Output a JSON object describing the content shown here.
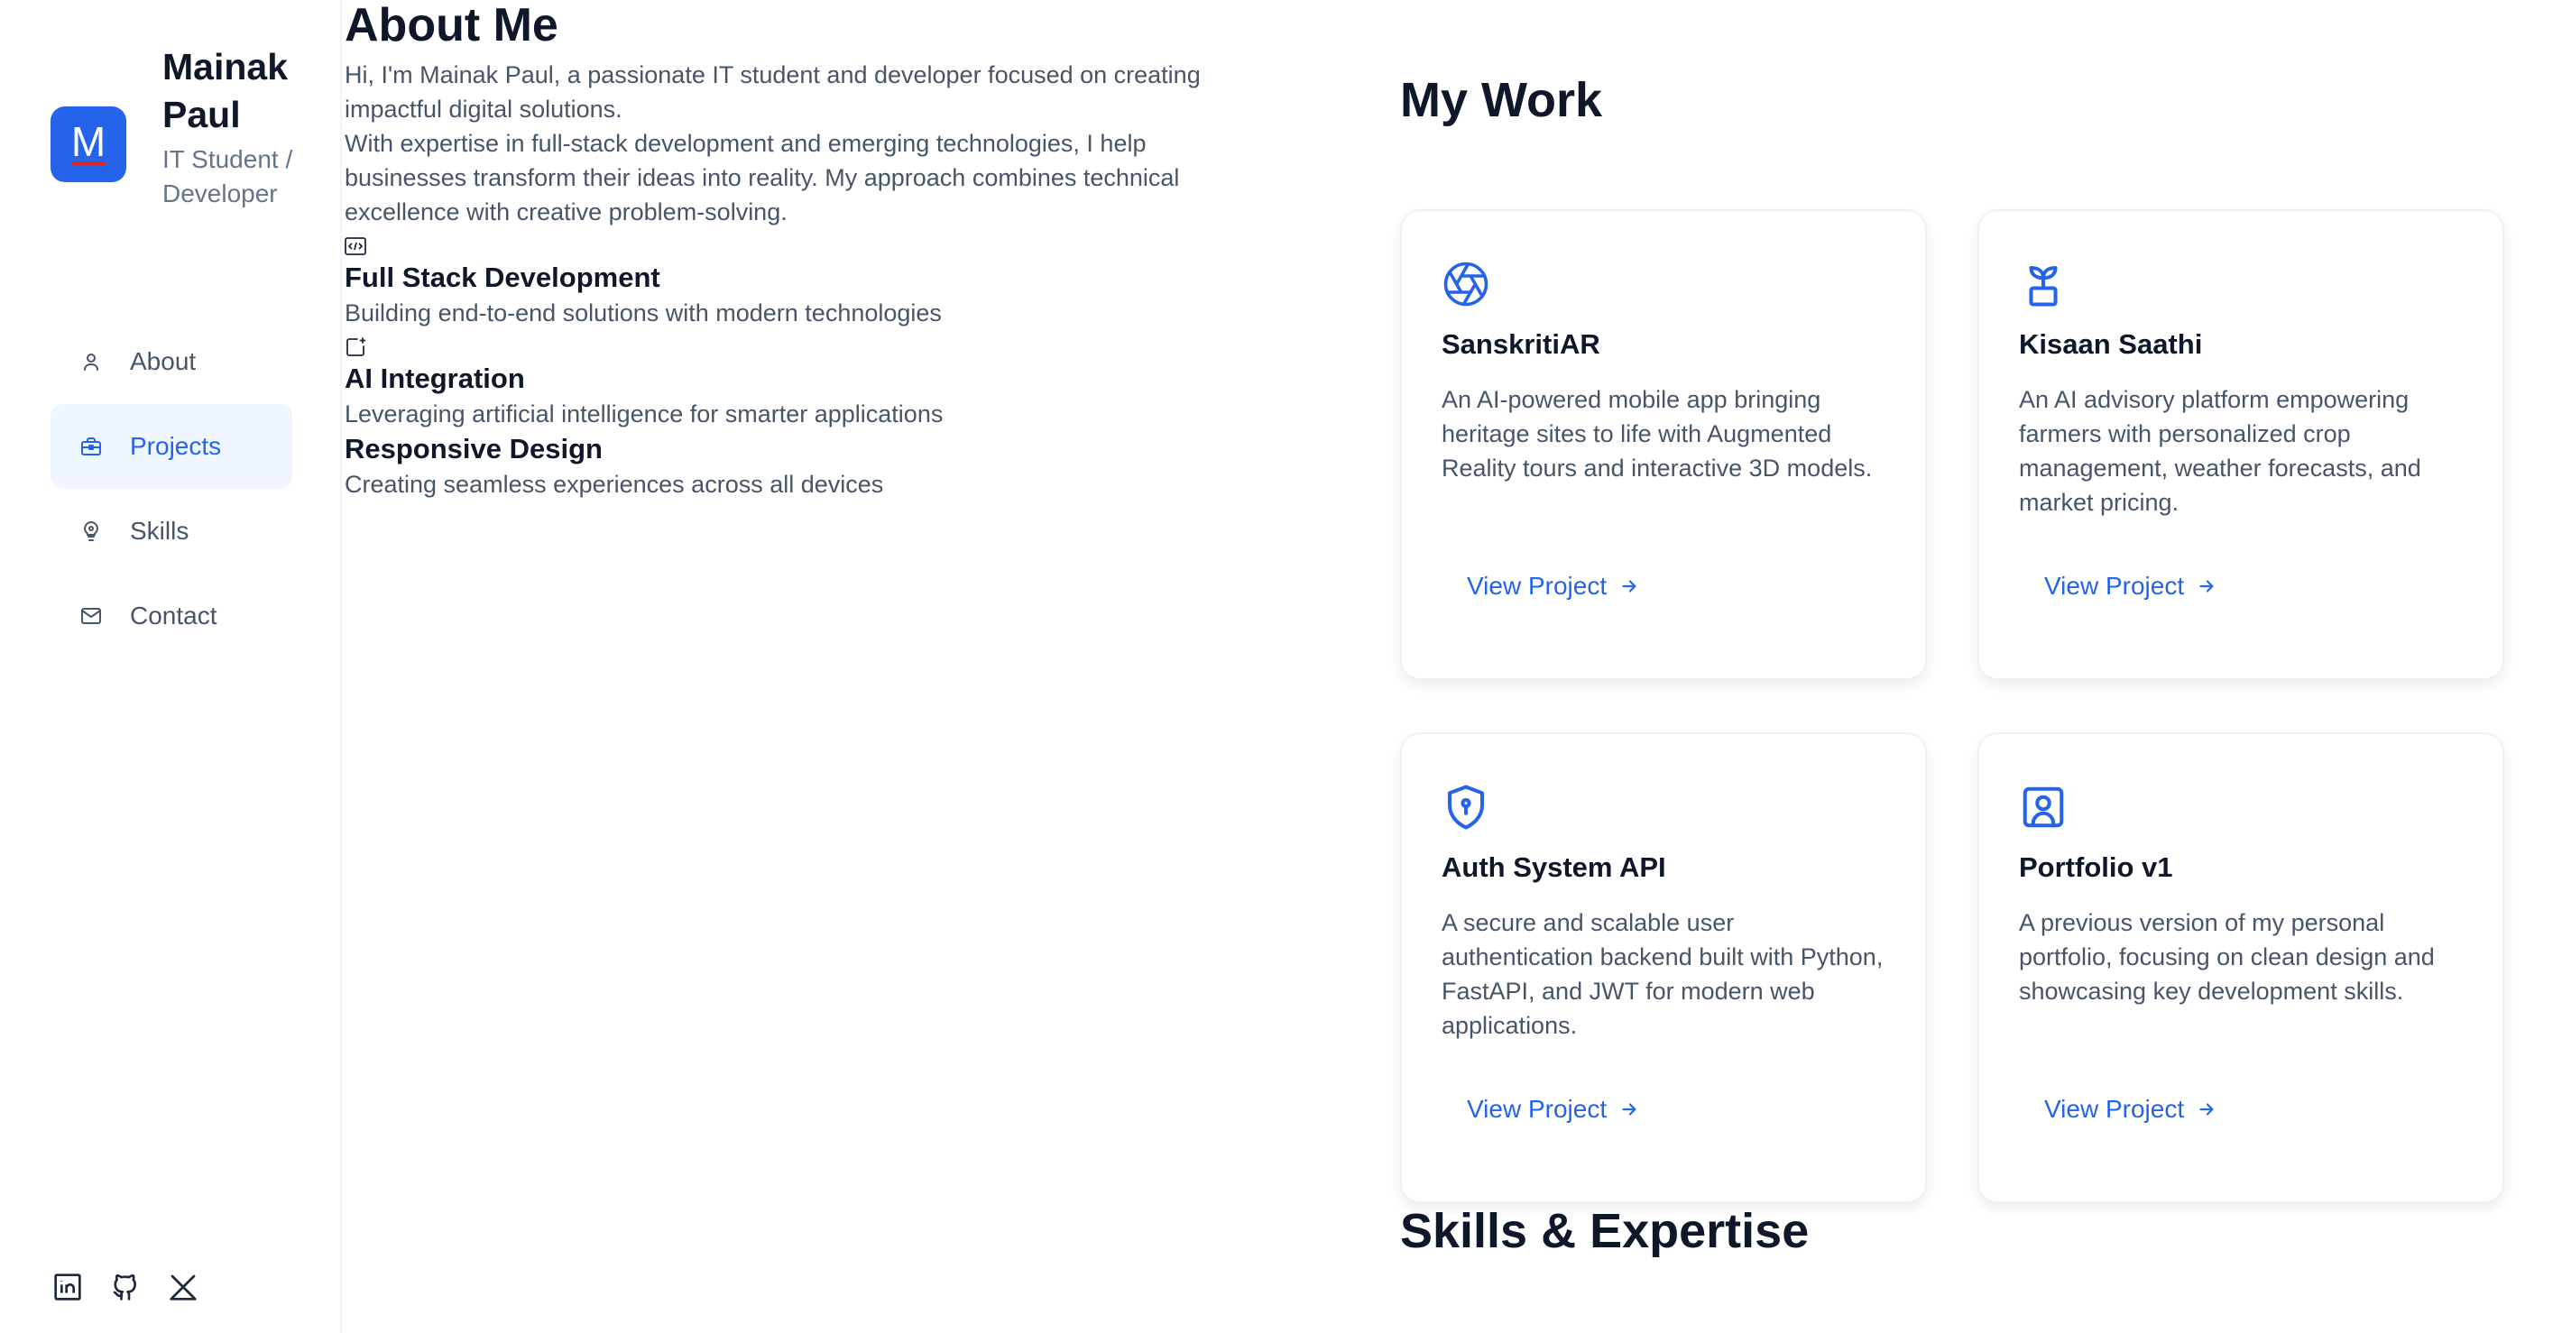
{
  "sidebar": {
    "avatar_letter": "M",
    "name": "Mainak Paul",
    "role": "IT Student / Developer",
    "nav": [
      {
        "label": "About",
        "icon": "user-icon",
        "active": false
      },
      {
        "label": "Projects",
        "icon": "briefcase-icon",
        "active": true
      },
      {
        "label": "Skills",
        "icon": "lightbulb-icon",
        "active": false
      },
      {
        "label": "Contact",
        "icon": "mail-icon",
        "active": false
      }
    ],
    "socials": [
      "linkedin-icon",
      "github-icon",
      "x-icon"
    ]
  },
  "about": {
    "title": "About Me",
    "intro": "Hi, I'm Mainak Paul, a passionate IT student and developer focused on creating impactful digital solutions.",
    "body": "With expertise in full-stack development and emerging technologies, I help businesses transform their ideas into reality. My approach combines technical excellence with creative problem-solving.",
    "features": [
      {
        "icon": "code-icon",
        "title": "Full Stack Development",
        "desc": "Building end-to-end solutions with modern technologies"
      },
      {
        "icon": "ai-icon",
        "title": "AI Integration",
        "desc": "Leveraging artificial intelligence for smarter applications"
      },
      {
        "icon": "",
        "title": "Responsive Design",
        "desc": "Creating seamless experiences across all devices"
      }
    ]
  },
  "work": {
    "title": "My Work",
    "link_label": "View Project",
    "projects": [
      {
        "icon": "aperture-icon",
        "title": "SanskritiAR",
        "desc": "An AI-powered mobile app bringing heritage sites to life with Augmented Reality tours and interactive 3D models."
      },
      {
        "icon": "sprout-icon",
        "title": "Kisaan Saathi",
        "desc": "An AI advisory platform empowering farmers with personalized crop management, weather forecasts, and market pricing."
      },
      {
        "icon": "shield-icon",
        "title": "Auth System API",
        "desc": "A secure and scalable user authentication backend built with Python, FastAPI, and JWT for modern web applications."
      },
      {
        "icon": "user-square-icon",
        "title": "Portfolio v1",
        "desc": "A previous version of my personal portfolio, focusing on clean design and showcasing key development skills."
      }
    ]
  },
  "skills": {
    "title": "Skills & Expertise"
  },
  "colors": {
    "accent": "#2563eb",
    "heading": "#0f172a",
    "body": "#475569",
    "active_bg": "#eff6ff"
  }
}
